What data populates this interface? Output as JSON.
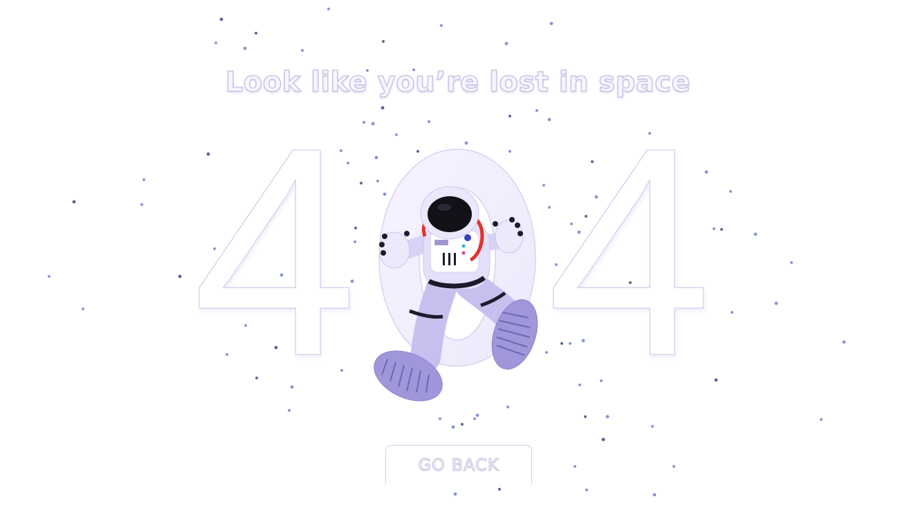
{
  "headline": "Look like you’re lost in space",
  "error_code": {
    "first": "4",
    "last": "4"
  },
  "button": {
    "label": "GO BACK"
  },
  "colors": {
    "accent": "#8f87d6",
    "outline": "#cfcce9",
    "suit_purple": "#b9b1e6",
    "helmet_ring": "#e0322c",
    "visor": "#111118",
    "star": "#5f7bc4"
  },
  "illustration": {
    "icon": "astronaut-icon"
  }
}
